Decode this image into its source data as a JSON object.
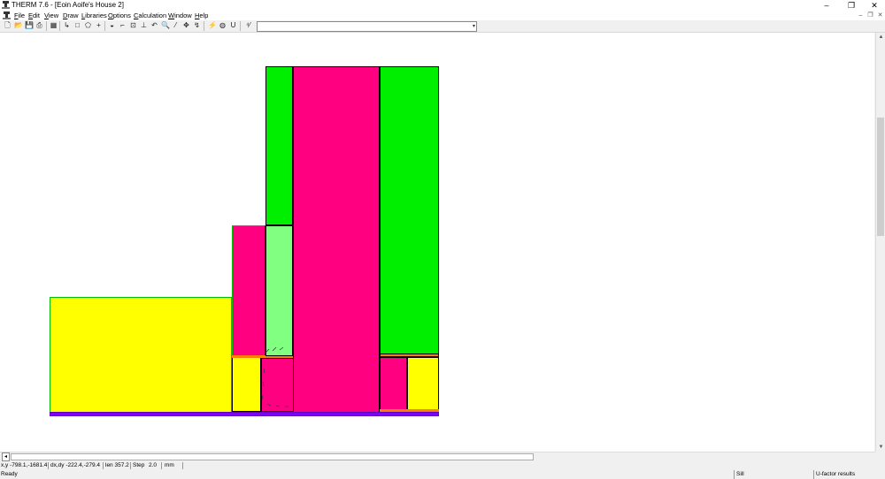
{
  "window": {
    "title": "THERM 7.6 - [Eoin Aoife's House 2]",
    "icons": {
      "app": "therm-app-icon",
      "minimize": "minimize-icon",
      "restore": "restore-icon",
      "close": "close-icon"
    }
  },
  "menu": {
    "items": [
      {
        "label": "File",
        "accel": "F"
      },
      {
        "label": "Edit",
        "accel": "E"
      },
      {
        "label": "View",
        "accel": "V"
      },
      {
        "label": "Draw",
        "accel": "D"
      },
      {
        "label": "Libraries",
        "accel": "L"
      },
      {
        "label": "Options",
        "accel": "O"
      },
      {
        "label": "Calculation",
        "accel": "C"
      },
      {
        "label": "Window",
        "accel": "W"
      },
      {
        "label": "Help",
        "accel": "H"
      }
    ],
    "mdi_icons": [
      "mdi-minimize-icon",
      "mdi-restore-icon",
      "mdi-close-icon"
    ]
  },
  "toolbar": {
    "combo_value": "",
    "icons": [
      "new-icon",
      "open-icon",
      "save-icon",
      "print-icon",
      "library-icon",
      "select-icon",
      "rectangle-icon",
      "polygon-icon",
      "locator-icon",
      "fill-icon",
      "point-icon",
      "insert-point-icon",
      "align-icon",
      "arc-icon",
      "zoom-icon",
      "dropper-icon",
      "pan-icon",
      "orient-icon",
      "calculate-icon",
      "results-icon",
      "ufactor-icon",
      "boundary-icon"
    ]
  },
  "colors": {
    "green": "#00ee00",
    "magenta": "#ff0080",
    "yellow": "#ffff00",
    "light_green": "#80ff80",
    "purple": "#8000ff",
    "orange": "#ff8000"
  },
  "coords": {
    "xy": "x,y -798.1,-1681.4",
    "dxdy": "dx,dy -222.4,-279.4",
    "len": "len 357.2",
    "step": "Step",
    "step_value": "2.0",
    "units": "mm"
  },
  "status": {
    "ready": "Ready",
    "boundary": "Sill",
    "results": "U-factor results"
  }
}
